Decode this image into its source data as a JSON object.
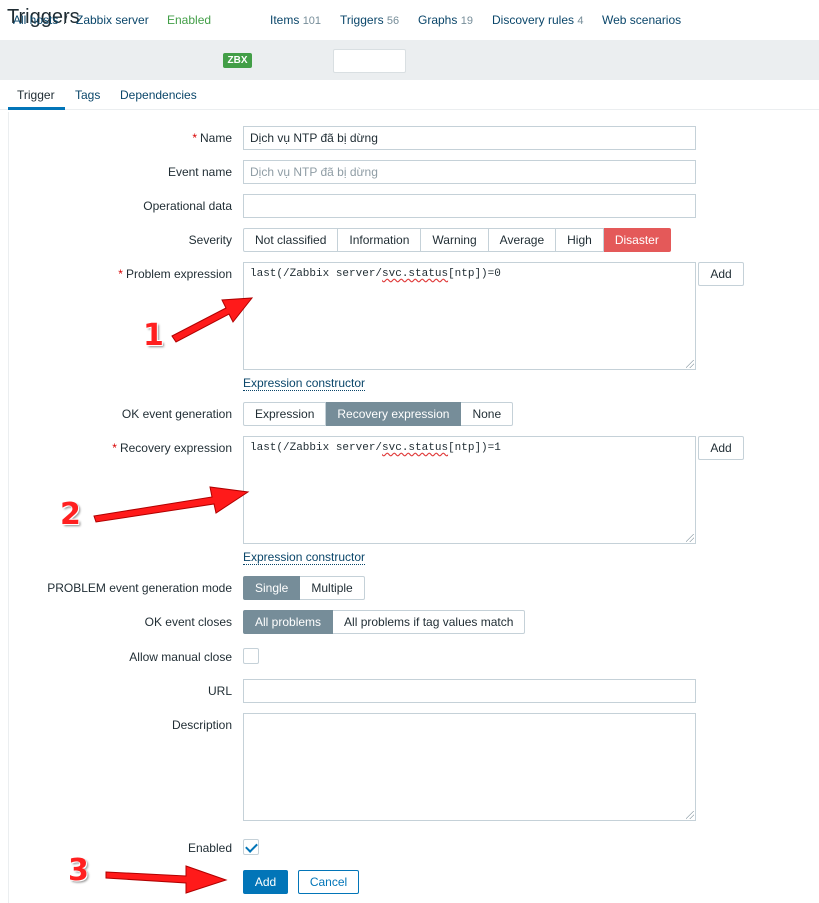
{
  "page": {
    "title": "Triggers"
  },
  "host_nav": {
    "all_hosts": "All hosts",
    "separator": "/",
    "host": "Zabbix server",
    "status": "Enabled",
    "badge": "ZBX",
    "items": {
      "label": "Items",
      "count": "101"
    },
    "triggers": {
      "label": "Triggers",
      "count": "56"
    },
    "graphs": {
      "label": "Graphs",
      "count": "19"
    },
    "discovery": {
      "label": "Discovery rules",
      "count": "4"
    },
    "web": {
      "label": "Web scenarios"
    }
  },
  "tabs": {
    "trigger": "Trigger",
    "tags": "Tags",
    "dependencies": "Dependencies"
  },
  "form": {
    "name": {
      "label": "Name",
      "required": "*",
      "value": "Dịch vụ NTP đã bị dừng"
    },
    "event_name": {
      "label": "Event name",
      "placeholder": "Dịch vụ NTP đã bị dừng"
    },
    "operational_data": {
      "label": "Operational data",
      "value": ""
    },
    "severity": {
      "label": "Severity",
      "options": [
        "Not classified",
        "Information",
        "Warning",
        "Average",
        "High",
        "Disaster"
      ],
      "selected": "Disaster"
    },
    "problem_expression": {
      "label": "Problem expression",
      "required": "*",
      "prefix": "last(/Zabbix server/",
      "func": "svc.status",
      "suffix": "[ntp])=0",
      "add": "Add",
      "constructor": "Expression constructor"
    },
    "ok_event_generation": {
      "label": "OK event generation",
      "options": [
        "Expression",
        "Recovery expression",
        "None"
      ],
      "selected": "Recovery expression"
    },
    "recovery_expression": {
      "label": "Recovery expression",
      "required": "*",
      "prefix": "last(/Zabbix server/",
      "func": "svc.status",
      "suffix": "[ntp])=1",
      "add": "Add",
      "constructor": "Expression constructor"
    },
    "problem_mode": {
      "label": "PROBLEM event generation mode",
      "options": [
        "Single",
        "Multiple"
      ],
      "selected": "Single"
    },
    "ok_event_closes": {
      "label": "OK event closes",
      "options": [
        "All problems",
        "All problems if tag values match"
      ],
      "selected": "All problems"
    },
    "allow_manual_close": {
      "label": "Allow manual close",
      "checked": false
    },
    "url": {
      "label": "URL",
      "value": ""
    },
    "description": {
      "label": "Description",
      "value": ""
    },
    "enabled": {
      "label": "Enabled",
      "checked": true
    },
    "buttons": {
      "add": "Add",
      "cancel": "Cancel"
    }
  },
  "annotations": {
    "one": "1",
    "two": "2",
    "three": "3",
    "color": "#ff2020"
  }
}
